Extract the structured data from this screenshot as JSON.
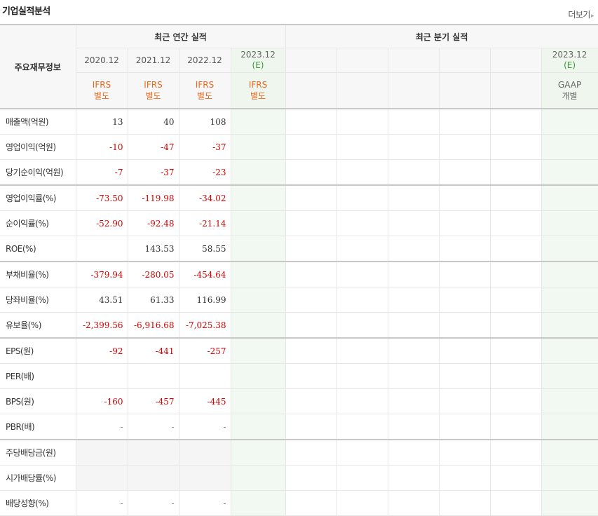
{
  "header": {
    "title": "기업실적분석",
    "more_label": "더보기",
    "more_arrow": "▸"
  },
  "table": {
    "row_header_label": "주요재무정보",
    "annual_group_label": "최근 연간 실적",
    "quarter_group_label": "최근 분기 실적",
    "annual_years": [
      "2020.12",
      "2021.12",
      "2022.12"
    ],
    "annual_est_year": "2023.12",
    "annual_est_suffix": "(E)",
    "annual_std_line1": [
      "IFRS",
      "IFRS",
      "IFRS",
      "IFRS"
    ],
    "annual_std_line2": [
      "별도",
      "별도",
      "별도",
      "별도"
    ],
    "quarter_est_year": "2023.12",
    "quarter_est_suffix": "(E)",
    "quarter_std_line1": "GAAP",
    "quarter_std_line2": "개별",
    "rows": [
      {
        "label": "매출액(억원)",
        "values": [
          "13",
          "40",
          "108"
        ]
      },
      {
        "label": "영업이익(억원)",
        "values": [
          "-10",
          "-47",
          "-37"
        ]
      },
      {
        "label": "당기순이익(억원)",
        "values": [
          "-7",
          "-37",
          "-23"
        ]
      },
      {
        "label": "영업이익률(%)",
        "values": [
          "-73.50",
          "-119.98",
          "-34.02"
        ]
      },
      {
        "label": "순이익률(%)",
        "values": [
          "-52.90",
          "-92.48",
          "-21.14"
        ]
      },
      {
        "label": "ROE(%)",
        "values": [
          "",
          "143.53",
          "58.55"
        ]
      },
      {
        "label": "부채비율(%)",
        "values": [
          "-379.94",
          "-280.05",
          "-454.64"
        ]
      },
      {
        "label": "당좌비율(%)",
        "values": [
          "43.51",
          "61.33",
          "116.99"
        ]
      },
      {
        "label": "유보율(%)",
        "values": [
          "-2,399.56",
          "-6,916.68",
          "-7,025.38"
        ]
      },
      {
        "label": "EPS(원)",
        "values": [
          "-92",
          "-441",
          "-257"
        ]
      },
      {
        "label": "PER(배)",
        "values": [
          "",
          "",
          ""
        ]
      },
      {
        "label": "BPS(원)",
        "values": [
          "-160",
          "-457",
          "-445"
        ]
      },
      {
        "label": "PBR(배)",
        "values": [
          "-",
          "-",
          "-"
        ]
      },
      {
        "label": "주당배당금(원)",
        "values": [
          "",
          "",
          ""
        ]
      },
      {
        "label": "시가배당률(%)",
        "values": [
          "",
          "",
          ""
        ]
      },
      {
        "label": "배당성향(%)",
        "values": [
          "-",
          "-",
          "-"
        ]
      }
    ]
  },
  "colors": {
    "negative": "#d40000",
    "standard": "#e8681c",
    "estimate_bg": "#f2f8f2"
  }
}
